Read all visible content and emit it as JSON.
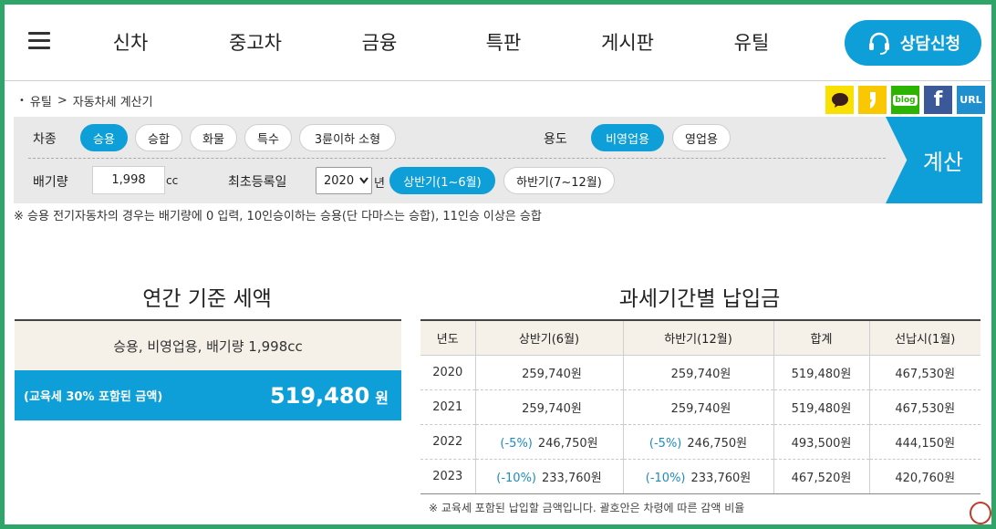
{
  "nav": {
    "items": [
      "신차",
      "중고차",
      "금융",
      "특판",
      "게시판",
      "유틸"
    ],
    "consult_label": "상담신청"
  },
  "breadcrumb": {
    "root": "유틸",
    "sep": ">",
    "current": "자동차세 계산기"
  },
  "share": {
    "blog": "blog",
    "url": "URL"
  },
  "form": {
    "car_type_label": "차종",
    "car_types": [
      "승용",
      "승합",
      "화물",
      "특수",
      "3륜이하 소형"
    ],
    "car_type_selected": "승용",
    "usage_label": "용도",
    "usages": [
      "비영업용",
      "영업용"
    ],
    "usage_selected": "비영업용",
    "displacement_label": "배기량",
    "displacement_value": "1,998",
    "displacement_unit": "cc",
    "reg_label": "최초등록일",
    "reg_year": "2020",
    "reg_year_suffix": "년",
    "halves": [
      "상반기(1~6월)",
      "하반기(7~12월)"
    ],
    "half_selected": "상반기(1~6월)",
    "calc_label": "계산",
    "note": "※ 승용 전기자동차의 경우는 배기량에 0 입력, 10인승이하는 승용(단 다마스는 승합), 11인승 이상은 승합"
  },
  "annual": {
    "title": "연간 기준 세액",
    "summary": "승용, 비영업용, 배기량 1,998cc",
    "amount_note": "(교육세 30% 포함된 금액)",
    "amount": "519,480",
    "amount_unit": "원"
  },
  "period": {
    "title": "과세기간별 납입금",
    "headers": [
      "년도",
      "상반기(6월)",
      "하반기(12월)",
      "합계",
      "선납시(1월)"
    ],
    "rows": [
      {
        "year": "2020",
        "h1_rate": "",
        "h1": "259,740원",
        "h2_rate": "",
        "h2": "259,740원",
        "total": "519,480원",
        "prepay": "467,530원"
      },
      {
        "year": "2021",
        "h1_rate": "",
        "h1": "259,740원",
        "h2_rate": "",
        "h2": "259,740원",
        "total": "519,480원",
        "prepay": "467,530원"
      },
      {
        "year": "2022",
        "h1_rate": "(-5%)",
        "h1": "246,750원",
        "h2_rate": "(-5%)",
        "h2": "246,750원",
        "total": "493,500원",
        "prepay": "444,150원"
      },
      {
        "year": "2023",
        "h1_rate": "(-10%)",
        "h1": "233,760원",
        "h2_rate": "(-10%)",
        "h2": "233,760원",
        "total": "467,520원",
        "prepay": "420,760원"
      }
    ],
    "note": "※ 교육세 포함된 납입할 금액입니다. 괄호안은 차령에 따른 감액 비율"
  },
  "colors": {
    "accent": "#0e9fd8",
    "frame": "#2fa56a",
    "rate": "#1f8ac0",
    "summary_bg": "#f6f1e8"
  },
  "icons": [
    "menu-icon",
    "headset-icon",
    "kakaotalk-icon",
    "kakaostory-icon",
    "naver-blog-icon",
    "facebook-icon",
    "url-icon",
    "select-arrow-icon"
  ]
}
